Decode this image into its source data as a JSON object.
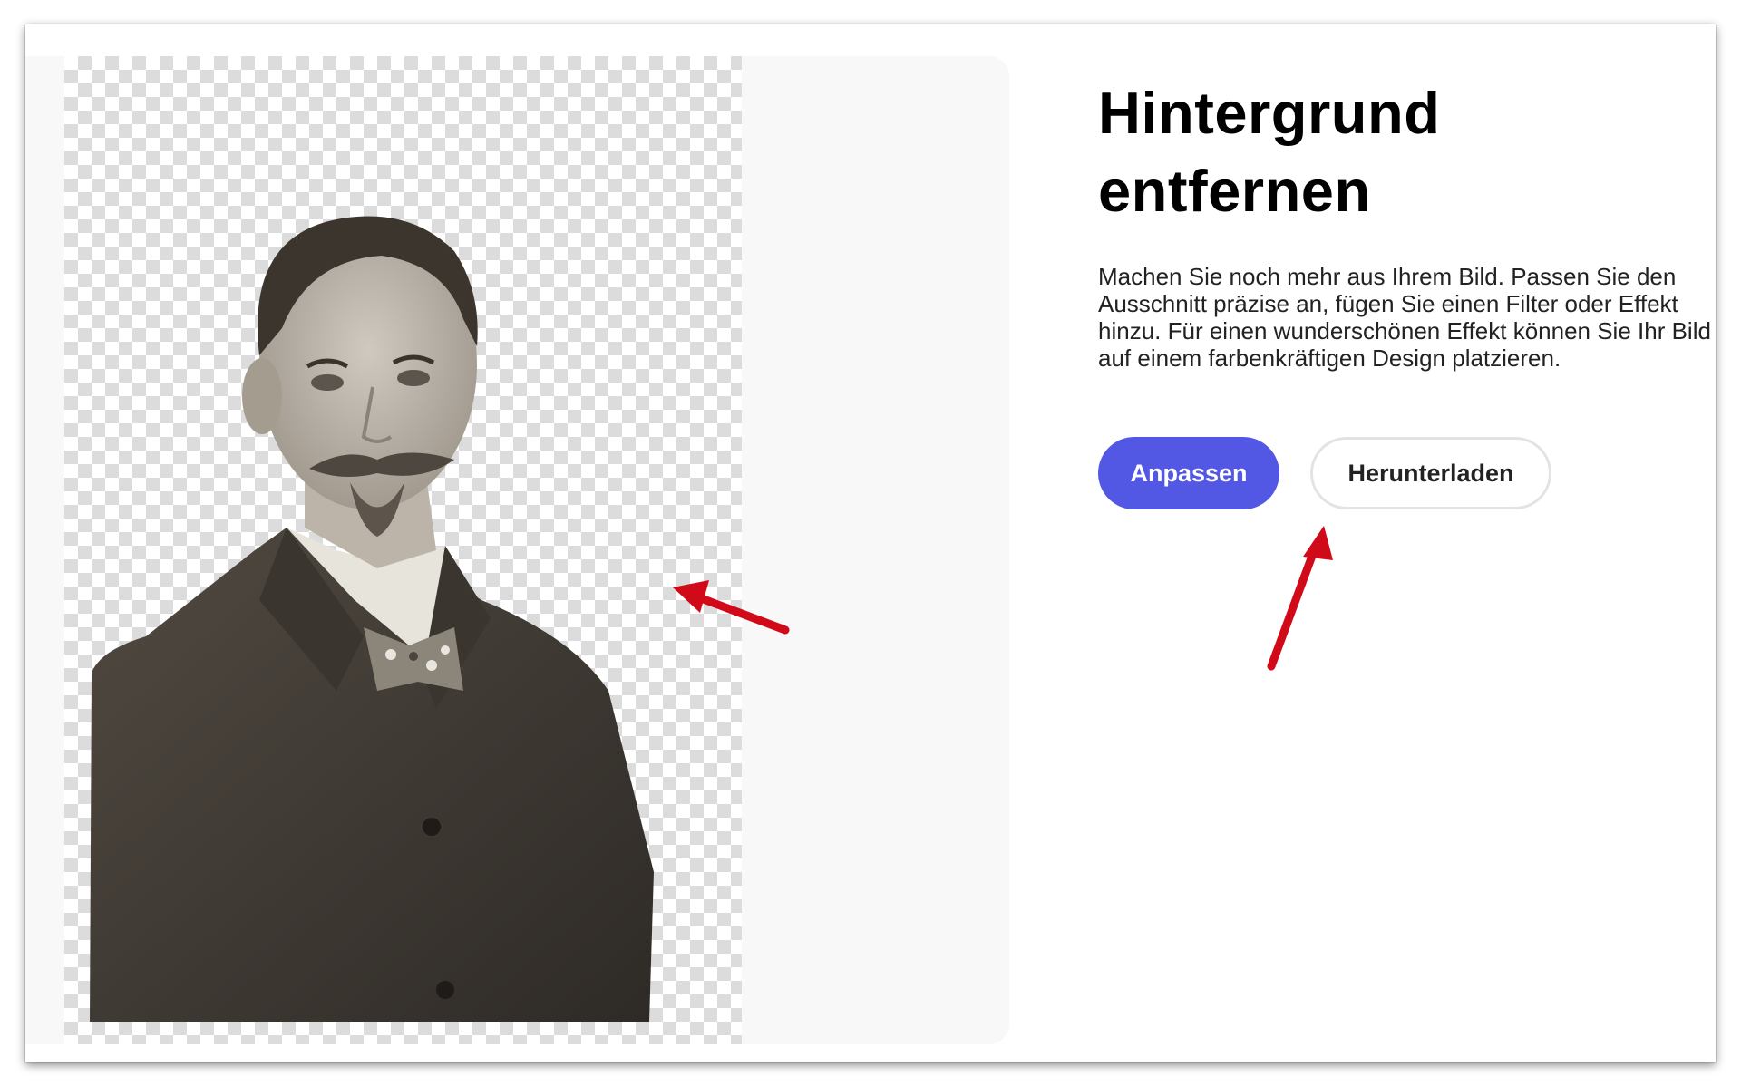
{
  "page": {
    "title_line1": "Hintergrund",
    "title_line2": "entfernen",
    "description": "Machen Sie noch mehr aus Ihrem Bild. Passen Sie den Ausschnitt präzise an, fügen Sie einen Filter oder Effekt hinzu. Für einen wunderschönen Effekt können Sie Ihr Bild auf einem farbenkräftigen Design platzieren."
  },
  "actions": {
    "primary_label": "Anpassen",
    "secondary_label": "Herunterladen"
  },
  "colors": {
    "primary_button": "#5258e4",
    "annotation_arrow": "#d10a1a"
  },
  "icons": {
    "annotation": "red-arrow-icon"
  }
}
